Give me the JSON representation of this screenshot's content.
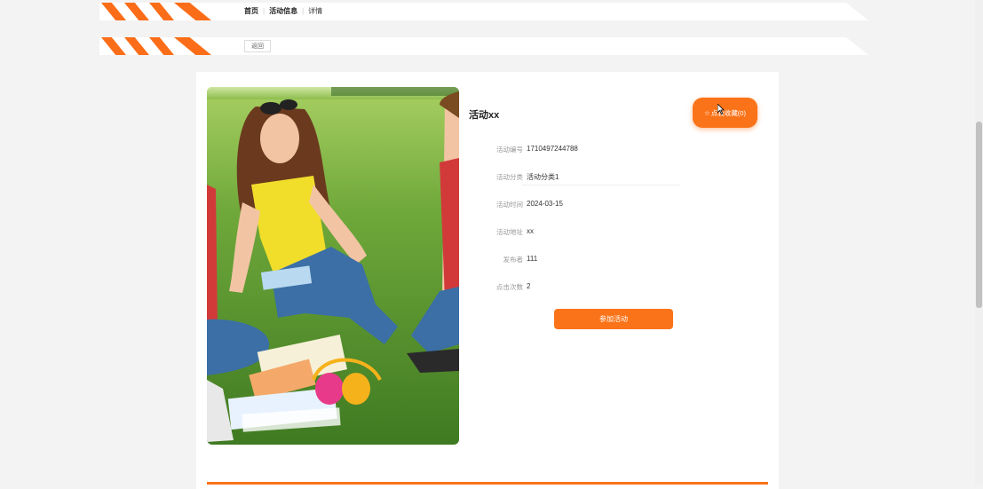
{
  "breadcrumb": {
    "home": "首页",
    "activity_info": "活动信息",
    "detail": "详情"
  },
  "back_label": "返回",
  "activity": {
    "title": "活动xx",
    "favorite_label": "点我收藏(0)",
    "fields": [
      {
        "label": "活动编号",
        "value": "1710497244788"
      },
      {
        "label": "活动分类",
        "value": "活动分类1"
      },
      {
        "label": "活动时间",
        "value": "2024-03-15"
      },
      {
        "label": "活动地址",
        "value": "xx"
      },
      {
        "label": "发布者",
        "value": "111"
      },
      {
        "label": "点击次数",
        "value": "2"
      }
    ],
    "join_label": "参加活动"
  },
  "icons": {
    "favorite": "star-icon",
    "photo": "activity-photo"
  },
  "colors": {
    "accent": "#fb7319",
    "page_bg": "#f3f3f3",
    "card_bg": "#ffffff"
  }
}
